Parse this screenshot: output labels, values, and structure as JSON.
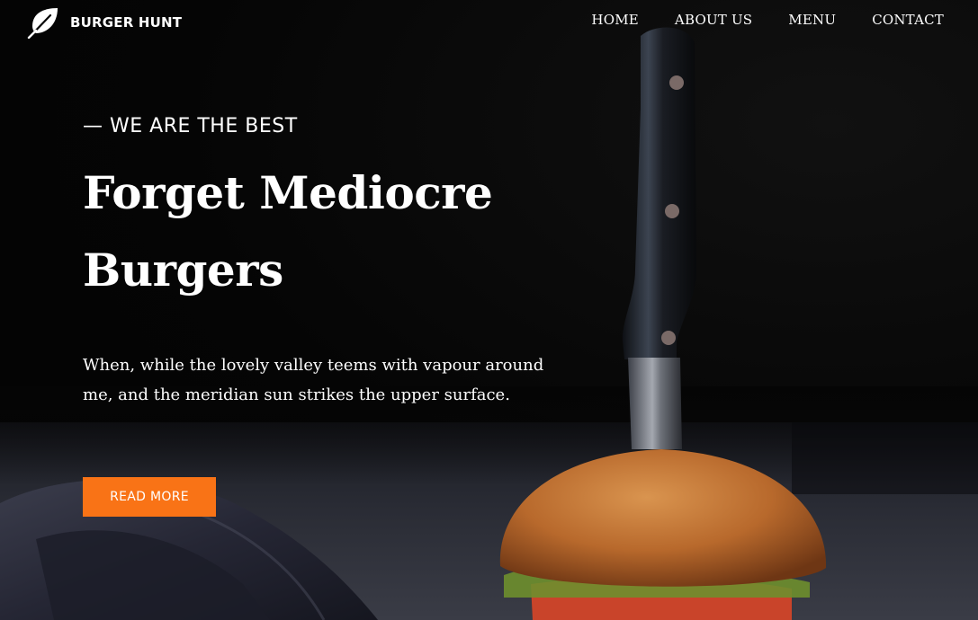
{
  "brand": {
    "name": "BURGER HUNT",
    "icon": "leaf-icon"
  },
  "nav": {
    "items": [
      {
        "label": "HOME"
      },
      {
        "label": "ABOUT US"
      },
      {
        "label": "MENU"
      },
      {
        "label": "CONTACT"
      }
    ]
  },
  "hero": {
    "eyebrow": "— WE ARE THE BEST",
    "headline": "Forget Mediocre Burgers",
    "lead": "When, while the lovely valley teems with vapour around me, and the meridian sun strikes the upper surface.",
    "cta_label": "READ MORE"
  },
  "colors": {
    "accent": "#f97316",
    "background": "#050505",
    "text": "#ffffff"
  }
}
